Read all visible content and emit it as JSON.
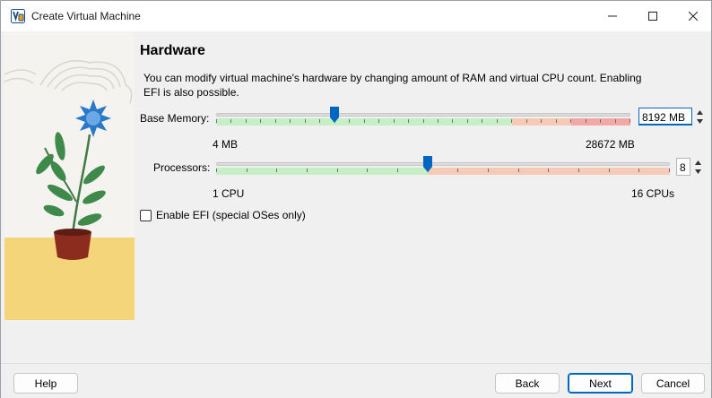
{
  "window": {
    "title": "Create Virtual Machine",
    "icons": {
      "app": "virtualbox-icon",
      "minimize": "minimize-icon",
      "maximize": "maximize-icon",
      "close": "close-icon"
    }
  },
  "page": {
    "title": "Hardware",
    "description": "You can modify virtual machine's hardware by changing amount of RAM and virtual CPU count. Enabling EFI is also possible."
  },
  "memory": {
    "label": "Base Memory:",
    "value": "8192",
    "unit": "MB",
    "min_label": "4 MB",
    "max_label": "28672 MB",
    "min": 4,
    "max": 28672,
    "current": 8192,
    "safe_limit": 20480,
    "warn_limit": 24576,
    "colors": {
      "safe": "#c6efc6",
      "warn": "#f7c9b7",
      "danger": "#f2a9a5",
      "handle": "#0067c0"
    }
  },
  "processors": {
    "label": "Processors:",
    "value": "8",
    "min_label": "1 CPU",
    "max_label": "16 CPUs",
    "min": 1,
    "max": 16,
    "current": 8,
    "safe_limit": 8,
    "colors": {
      "safe": "#c6efc6",
      "warn": "#f7c9b7",
      "handle": "#0067c0"
    }
  },
  "efi": {
    "label": "Enable EFI (special OSes only)",
    "checked": false
  },
  "buttons": {
    "help": "Help",
    "back": "Back",
    "next": "Next",
    "cancel": "Cancel"
  },
  "illustration": {
    "name": "potted-flower-illustration",
    "colors": {
      "sky": "#f5f3ef",
      "ground": "#f5d57a",
      "flower": "#2a78c8",
      "leaf": "#3f8a4a",
      "pot": "#8b2c1f"
    }
  }
}
